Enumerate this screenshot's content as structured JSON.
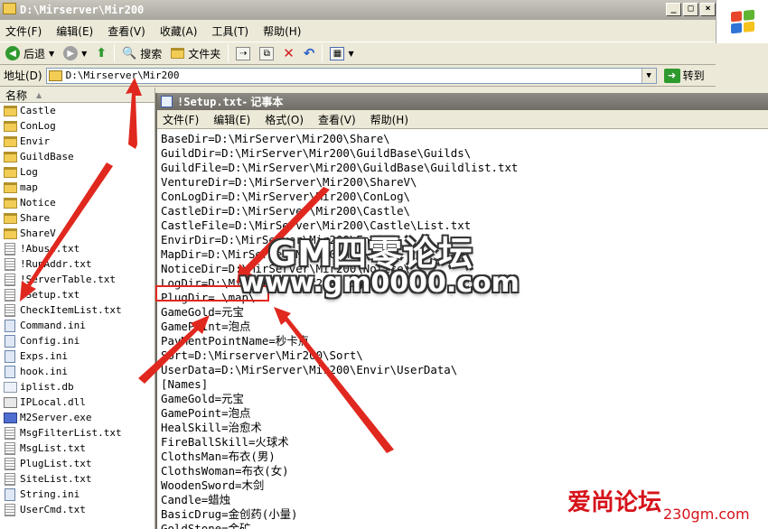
{
  "explorer": {
    "title": "D:\\Mirserver\\Mir200",
    "menu": [
      "文件(F)",
      "编辑(E)",
      "查看(V)",
      "收藏(A)",
      "工具(T)",
      "帮助(H)"
    ],
    "toolbar": {
      "back_label": "后退",
      "search_label": "搜索",
      "folders_label": "文件夹"
    },
    "address": {
      "label": "地址(D)",
      "value": "D:\\Mirserver\\Mir200",
      "go_label": "转到"
    },
    "column_header": "名称",
    "files": [
      {
        "name": "Castle",
        "type": "folder"
      },
      {
        "name": "ConLog",
        "type": "folder"
      },
      {
        "name": "Envir",
        "type": "folder"
      },
      {
        "name": "GuildBase",
        "type": "folder"
      },
      {
        "name": "Log",
        "type": "folder"
      },
      {
        "name": "map",
        "type": "folder"
      },
      {
        "name": "Notice",
        "type": "folder"
      },
      {
        "name": "Share",
        "type": "folder"
      },
      {
        "name": "ShareV",
        "type": "folder"
      },
      {
        "name": "!Abuse.txt",
        "type": "txt"
      },
      {
        "name": "!RunAddr.txt",
        "type": "txt"
      },
      {
        "name": "!ServerTable.txt",
        "type": "txt"
      },
      {
        "name": "!Setup.txt",
        "type": "txt"
      },
      {
        "name": "CheckItemList.txt",
        "type": "txt"
      },
      {
        "name": "Command.ini",
        "type": "ini"
      },
      {
        "name": "Config.ini",
        "type": "ini"
      },
      {
        "name": "Exps.ini",
        "type": "ini"
      },
      {
        "name": "hook.ini",
        "type": "ini"
      },
      {
        "name": "iplist.db",
        "type": "db"
      },
      {
        "name": "IPLocal.dll",
        "type": "dll"
      },
      {
        "name": "M2Server.exe",
        "type": "exe"
      },
      {
        "name": "MsgFilterList.txt",
        "type": "txt"
      },
      {
        "name": "MsgList.txt",
        "type": "txt"
      },
      {
        "name": "PlugList.txt",
        "type": "txt"
      },
      {
        "name": "SiteList.txt",
        "type": "txt"
      },
      {
        "name": "String.ini",
        "type": "ini"
      },
      {
        "name": "UserCmd.txt",
        "type": "txt"
      }
    ]
  },
  "notepad": {
    "title_file": "!Setup.txt",
    "title_app": " - 记事本",
    "menu": [
      "文件(F)",
      "编辑(E)",
      "格式(O)",
      "查看(V)",
      "帮助(H)"
    ],
    "lines": [
      "BaseDir=D:\\MirServer\\Mir200\\Share\\",
      "GuildDir=D:\\MirServer\\Mir200\\GuildBase\\Guilds\\",
      "GuildFile=D:\\MirServer\\Mir200\\GuildBase\\Guildlist.txt",
      "VentureDir=D:\\MirServer\\Mir200\\ShareV\\",
      "ConLogDir=D:\\MirServer\\Mir200\\ConLog\\",
      "CastleDir=D:\\MirServer\\Mir200\\Castle\\",
      "CastleFile=D:\\MirServer\\Mir200\\Castle\\List.txt",
      "EnvirDir=D:\\MirServer\\Mir200\\Envir\\",
      "MapDir=D:\\MirServer\\Mir200\\Map\\",
      "NoticeDir=D:\\MirServer\\Mir200\\Notice\\",
      "LogDir=D:\\MirServer\\Mir200\\Log\\",
      "PlugDir=.\\map\\",
      "GameGold=元宝",
      "GamePoint=泡点",
      "PayMentPointName=秒卡点",
      "Sort=D:\\Mirserver\\Mir200\\Sort\\",
      "UserData=D:\\MirServer\\Mir200\\Envir\\UserData\\",
      "[Names]",
      "GameGold=元宝",
      "GamePoint=泡点",
      "HealSkill=治愈术",
      "FireBallSkill=火球术",
      "ClothsMan=布衣(男)",
      "ClothsWoman=布衣(女)",
      "WoodenSword=木剑",
      "Candle=蜡烛",
      "BasicDrug=金创药(小量)",
      "GoldStone=金矿"
    ]
  },
  "watermarks": {
    "main_line1": "GM四零论坛",
    "main_line2": "www.gm0000.com",
    "corner_line1": "爱尚论坛",
    "corner_line2": "230gm.com"
  },
  "colors": {
    "annotation_red": "#e0281f",
    "watermark_red": "#d6121a"
  }
}
